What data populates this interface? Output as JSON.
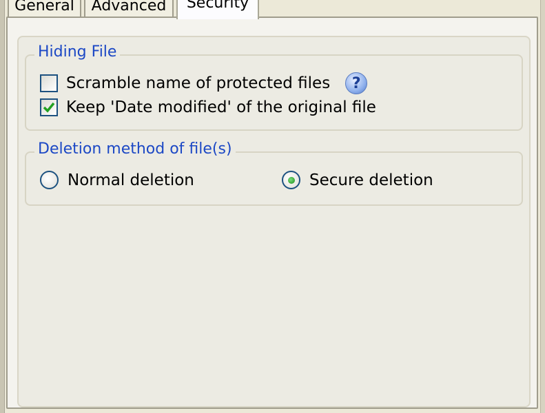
{
  "tabs": [
    {
      "label": "General"
    },
    {
      "label": "Advanced"
    },
    {
      "label": "Security"
    }
  ],
  "active_tab": "Security",
  "hiding_group": {
    "title": "Hiding File",
    "scramble": {
      "label": "Scramble name of protected files",
      "checked": false
    },
    "help_icon": "question-mark",
    "keep_date": {
      "label": "Keep 'Date modified' of the original file",
      "checked": true
    }
  },
  "deletion_group": {
    "title": "Deletion method of file(s)",
    "options": [
      {
        "label": "Normal deletion",
        "selected": false
      },
      {
        "label": "Secure deletion",
        "selected": true
      }
    ]
  },
  "colors": {
    "accent": "#1c48c5",
    "check": "#21a121",
    "active_tab_highlight": "#f0a83c"
  }
}
